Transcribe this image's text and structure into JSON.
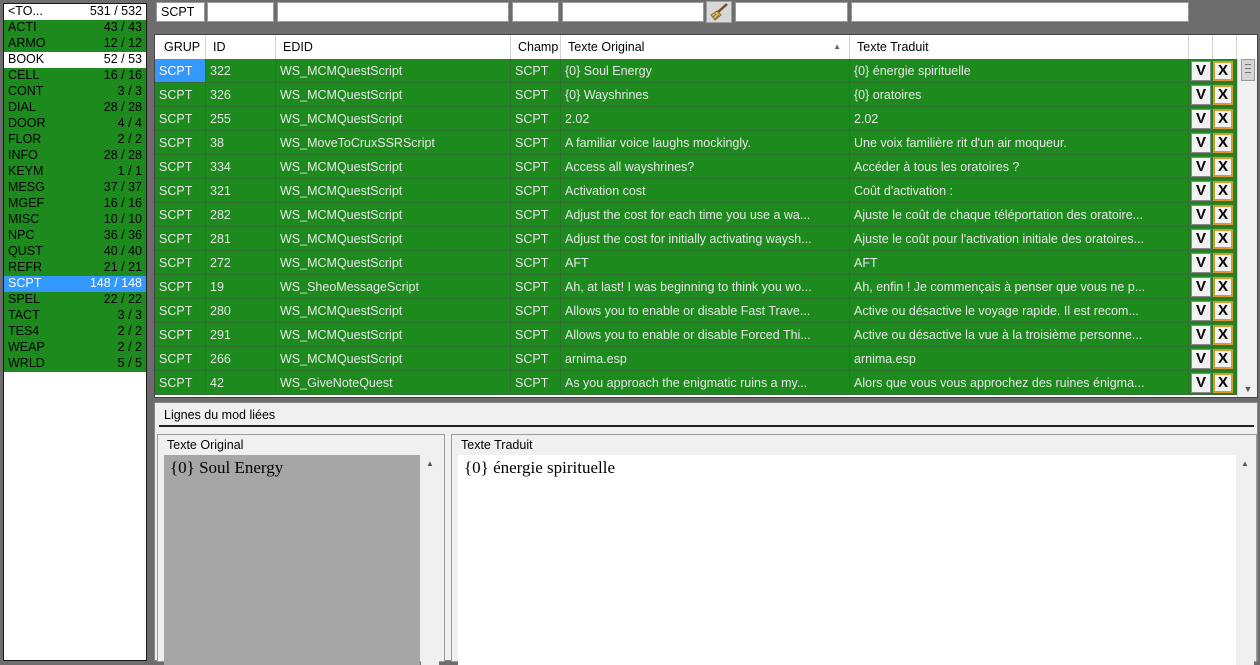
{
  "categories": [
    {
      "name": "<TO...",
      "count": "531 / 532",
      "style": "white"
    },
    {
      "name": "ACTI",
      "count": "43 / 43",
      "style": "green"
    },
    {
      "name": "ARMO",
      "count": "12 / 12",
      "style": "green"
    },
    {
      "name": "BOOK",
      "count": "52 / 53",
      "style": "white"
    },
    {
      "name": "CELL",
      "count": "16 / 16",
      "style": "green"
    },
    {
      "name": "CONT",
      "count": "3 / 3",
      "style": "green"
    },
    {
      "name": "DIAL",
      "count": "28 / 28",
      "style": "green"
    },
    {
      "name": "DOOR",
      "count": "4 / 4",
      "style": "green"
    },
    {
      "name": "FLOR",
      "count": "2 / 2",
      "style": "green"
    },
    {
      "name": "INFO",
      "count": "28 / 28",
      "style": "green"
    },
    {
      "name": "KEYM",
      "count": "1 / 1",
      "style": "green"
    },
    {
      "name": "MESG",
      "count": "37 / 37",
      "style": "green"
    },
    {
      "name": "MGEF",
      "count": "16 / 16",
      "style": "green"
    },
    {
      "name": "MISC",
      "count": "10 / 10",
      "style": "green"
    },
    {
      "name": "NPC",
      "count": "36 / 36",
      "style": "green"
    },
    {
      "name": "QUST",
      "count": "40 / 40",
      "style": "green"
    },
    {
      "name": "REFR",
      "count": "21 / 21",
      "style": "green"
    },
    {
      "name": "SCPT",
      "count": "148 / 148",
      "style": "blue"
    },
    {
      "name": "SPEL",
      "count": "22 / 22",
      "style": "green"
    },
    {
      "name": "TACT",
      "count": "3 / 3",
      "style": "green"
    },
    {
      "name": "TES4",
      "count": "2 / 2",
      "style": "green"
    },
    {
      "name": "WEAP",
      "count": "2 / 2",
      "style": "green"
    },
    {
      "name": "WRLD",
      "count": "5 / 5",
      "style": "green"
    }
  ],
  "filter": {
    "group_value": "SCPT",
    "id_value": "",
    "edid_value": "",
    "champ_value": "",
    "original_value": "",
    "broom_icon": "broom-icon",
    "traduit_extra_value": "",
    "traduit_value": ""
  },
  "grid": {
    "headers": {
      "grup": "GRUP",
      "id": "ID",
      "edid": "EDID",
      "champ": "Champ",
      "original": "Texte Original",
      "traduit": "Texte Traduit"
    },
    "rows": [
      {
        "grup": "SCPT",
        "id": "322",
        "edid": "WS_MCMQuestScript",
        "champ": "SCPT",
        "original": "{0} Soul Energy",
        "traduit": "{0} énergie spirituelle"
      },
      {
        "grup": "SCPT",
        "id": "326",
        "edid": "WS_MCMQuestScript",
        "champ": "SCPT",
        "original": "{0} Wayshrines",
        "traduit": "{0} oratoires"
      },
      {
        "grup": "SCPT",
        "id": "255",
        "edid": "WS_MCMQuestScript",
        "champ": "SCPT",
        "original": "2.02",
        "traduit": "2.02"
      },
      {
        "grup": "SCPT",
        "id": "38",
        "edid": "WS_MoveToCruxSSRScript",
        "champ": "SCPT",
        "original": "A familiar voice laughs mockingly.",
        "traduit": "Une voix familière rit d'un air moqueur."
      },
      {
        "grup": "SCPT",
        "id": "334",
        "edid": "WS_MCMQuestScript",
        "champ": "SCPT",
        "original": "Access all wayshrines?",
        "traduit": "Accéder à tous les oratoires ?"
      },
      {
        "grup": "SCPT",
        "id": "321",
        "edid": "WS_MCMQuestScript",
        "champ": "SCPT",
        "original": "Activation cost",
        "traduit": "Coût d'activation :"
      },
      {
        "grup": "SCPT",
        "id": "282",
        "edid": "WS_MCMQuestScript",
        "champ": "SCPT",
        "original": "Adjust the cost for each time you use a wa...",
        "traduit": "Ajuste le coût de chaque téléportation des oratoire..."
      },
      {
        "grup": "SCPT",
        "id": "281",
        "edid": "WS_MCMQuestScript",
        "champ": "SCPT",
        "original": "Adjust the cost for initially activating waysh...",
        "traduit": "Ajuste le coût pour l'activation initiale des oratoires..."
      },
      {
        "grup": "SCPT",
        "id": "272",
        "edid": "WS_MCMQuestScript",
        "champ": "SCPT",
        "original": "AFT",
        "traduit": "AFT"
      },
      {
        "grup": "SCPT",
        "id": "19",
        "edid": "WS_SheoMessageScript",
        "champ": "SCPT",
        "original": "Ah, at last! I was beginning to think you wo...",
        "traduit": "Ah, enfin ! Je commençais à penser que vous ne p..."
      },
      {
        "grup": "SCPT",
        "id": "280",
        "edid": "WS_MCMQuestScript",
        "champ": "SCPT",
        "original": "Allows you to enable or disable Fast Trave...",
        "traduit": "Active ou désactive le voyage rapide. Il est recom..."
      },
      {
        "grup": "SCPT",
        "id": "291",
        "edid": "WS_MCMQuestScript",
        "champ": "SCPT",
        "original": "Allows you to enable or disable Forced Thi...",
        "traduit": "Active ou désactive la vue à la troisième personne..."
      },
      {
        "grup": "SCPT",
        "id": "266",
        "edid": "WS_MCMQuestScript",
        "champ": "SCPT",
        "original": "arnima.esp",
        "traduit": "arnima.esp"
      },
      {
        "grup": "SCPT",
        "id": "42",
        "edid": "WS_GiveNoteQuest",
        "champ": "SCPT",
        "original": "As you approach the enigmatic ruins a my...",
        "traduit": "Alors que vous vous approchez des ruines énigma..."
      }
    ],
    "validate_label": "V",
    "reject_label": "X",
    "sort_arrow": "▲"
  },
  "linked": {
    "title": "Lignes du mod liées",
    "original_label": "Texte Original",
    "original_text": "{0} Soul Energy",
    "traduit_label": "Texte Traduit",
    "traduit_text": "{0} énergie spirituelle"
  }
}
